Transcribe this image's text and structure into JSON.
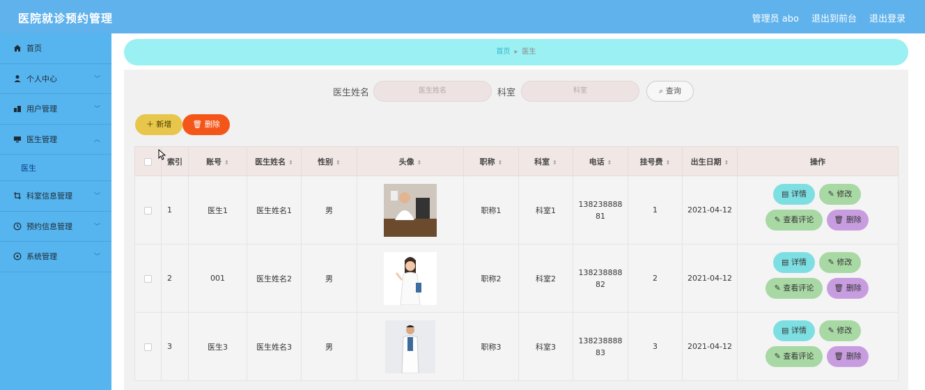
{
  "header": {
    "title": "医院就诊预约管理",
    "admin": "管理员 abo",
    "front": "退出到前台",
    "logout": "退出登录"
  },
  "sidebar": {
    "items": [
      {
        "label": "首页",
        "icon": "home-icon"
      },
      {
        "label": "个人中心",
        "icon": "user-icon"
      },
      {
        "label": "用户管理",
        "icon": "users-icon"
      },
      {
        "label": "医生管理",
        "icon": "monitor-icon"
      },
      {
        "label": "科室信息管理",
        "icon": "crop-icon"
      },
      {
        "label": "预约信息管理",
        "icon": "clock-icon"
      },
      {
        "label": "系统管理",
        "icon": "settings-icon"
      }
    ],
    "sub_item": "医生"
  },
  "breadcrumb": {
    "home": "首页",
    "current": "医生"
  },
  "search": {
    "name_label": "医生姓名",
    "name_placeholder": "医生姓名",
    "dept_label": "科室",
    "dept_placeholder": "科室",
    "query": "查询"
  },
  "actions": {
    "add": "新增",
    "delete": "删除"
  },
  "table": {
    "headers": [
      "索引",
      "账号",
      "医生姓名",
      "性别",
      "头像",
      "职称",
      "科室",
      "电话",
      "挂号费",
      "出生日期",
      "操作"
    ],
    "rows": [
      {
        "index": "1",
        "account": "医生1",
        "name": "医生姓名1",
        "gender": "男",
        "title": "职称1",
        "dept": "科室1",
        "phone1": "138238888",
        "phone2": "81",
        "fee": "1",
        "birth": "2021-04-12"
      },
      {
        "index": "2",
        "account": "001",
        "name": "医生姓名2",
        "gender": "男",
        "title": "职称2",
        "dept": "科室2",
        "phone1": "138238888",
        "phone2": "82",
        "fee": "2",
        "birth": "2021-04-12"
      },
      {
        "index": "3",
        "account": "医生3",
        "name": "医生姓名3",
        "gender": "男",
        "title": "职称3",
        "dept": "科室3",
        "phone1": "138238888",
        "phone2": "83",
        "fee": "3",
        "birth": "2021-04-12"
      }
    ],
    "ops": {
      "detail": "详情",
      "edit": "修改",
      "comment": "查看评论",
      "remove": "删除"
    }
  }
}
